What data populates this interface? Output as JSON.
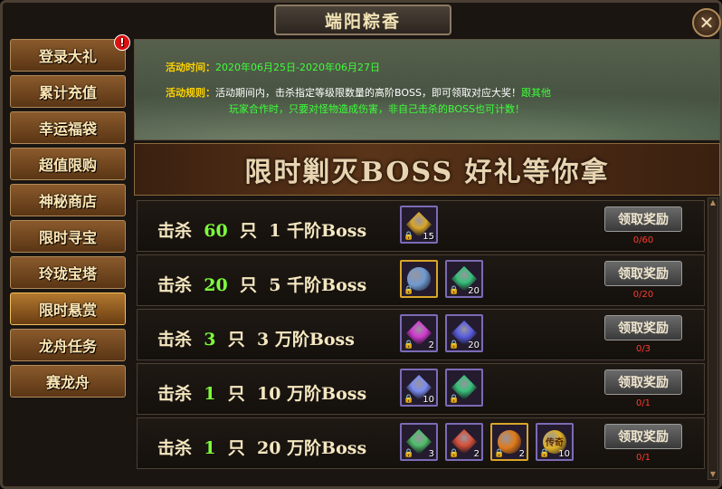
{
  "title": "端阳粽香",
  "close_label": "✕",
  "sidebar": {
    "items": [
      {
        "label": "登录大礼",
        "badge": "!"
      },
      {
        "label": "累计充值"
      },
      {
        "label": "幸运福袋"
      },
      {
        "label": "超值限购"
      },
      {
        "label": "神秘商店"
      },
      {
        "label": "限时寻宝"
      },
      {
        "label": "玲珑宝塔"
      },
      {
        "label": "限时悬赏",
        "active": true
      },
      {
        "label": "龙舟任务"
      },
      {
        "label": "赛龙舟"
      }
    ]
  },
  "info": {
    "time_label": "活动时间：",
    "time_value": "2020年06月25日-2020年06月27日",
    "rule_label": "活动规则：",
    "rule_text_1": "活动期间内，击杀指定等级限数量的高阶BOSS，即可领取对应大奖！",
    "rule_green_1": "跟其他",
    "rule_green_2": "玩家合作时，只要对怪物造成伤害，非自己击杀的BOSS也可计数！"
  },
  "banner": "限时剿灭BOSS  好礼等你拿",
  "rows": [
    {
      "kill": "击杀",
      "count": "60",
      "unit": "只",
      "tier": "1",
      "rank": "千阶Boss",
      "progress": "0/60",
      "claim": "领取奖励",
      "items": [
        {
          "icon": "treasure-chest-icon",
          "color": "#d9a62a",
          "count": "15",
          "gold": false
        }
      ]
    },
    {
      "kill": "击杀",
      "count": "20",
      "unit": "只",
      "tier": "5",
      "rank": "千阶Boss",
      "progress": "0/20",
      "claim": "领取奖励",
      "items": [
        {
          "icon": "compass-disc-icon",
          "color": "#6f9ad0",
          "count": "",
          "gold": true
        },
        {
          "icon": "green-crystal-icon",
          "color": "#38c07a",
          "count": "20",
          "gold": false
        }
      ]
    },
    {
      "kill": "击杀",
      "count": "3",
      "unit": "只",
      "tier": "3",
      "rank": "万阶Boss",
      "progress": "0/3",
      "claim": "领取奖励",
      "items": [
        {
          "icon": "purple-gem-icon",
          "color": "#d23bd0",
          "count": "2",
          "gold": false
        },
        {
          "icon": "blue-crystal-icon",
          "color": "#5a5ee0",
          "count": "20",
          "gold": false
        }
      ]
    },
    {
      "kill": "击杀",
      "count": "1",
      "unit": "只",
      "tier": "10",
      "rank": "万阶Boss",
      "progress": "0/1",
      "claim": "领取奖励",
      "items": [
        {
          "icon": "feather-icon",
          "color": "#7a8cf0",
          "count": "10",
          "gold": false
        },
        {
          "icon": "green-crystal-icon",
          "color": "#38c07a",
          "count": "",
          "gold": false
        }
      ]
    },
    {
      "kill": "击杀",
      "count": "1",
      "unit": "只",
      "tier": "20",
      "rank": "万阶Boss",
      "progress": "0/1",
      "claim": "领取奖励",
      "items": [
        {
          "icon": "jade-pendant-icon",
          "color": "#4fbf6a",
          "count": "3",
          "gold": false
        },
        {
          "icon": "red-crystal-icon",
          "color": "#d8503a",
          "count": "2",
          "gold": false
        },
        {
          "icon": "orange-orb-icon",
          "color": "#e07a1a",
          "count": "2",
          "gold": true
        },
        {
          "icon": "legend-coin-icon",
          "color": "#e0b22a",
          "count": "10",
          "gold": false,
          "text": "传奇"
        }
      ]
    }
  ]
}
